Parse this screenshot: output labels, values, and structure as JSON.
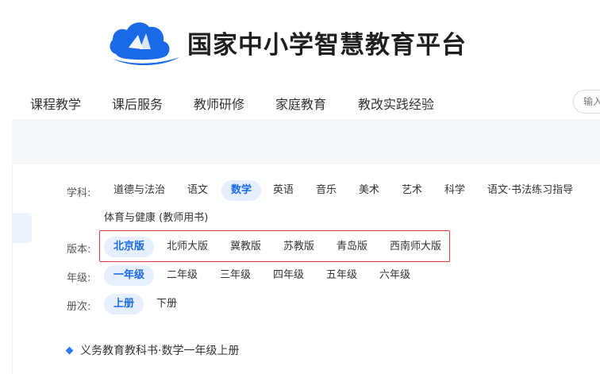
{
  "header": {
    "logo_text": "国家中小学智慧教育平台",
    "logo_icon": "cloud-book-icon",
    "brand_color": "#1a6ae8"
  },
  "nav": {
    "items": [
      "课程教学",
      "课后服务",
      "教师研修",
      "家庭教育",
      "教改实践经验"
    ],
    "search_placeholder": "输入"
  },
  "filters": {
    "subject": {
      "label": "学科:",
      "options": [
        "道德与法治",
        "语文",
        "数学",
        "英语",
        "音乐",
        "美术",
        "艺术",
        "科学",
        "语文·书法练习指导",
        "体育与健康 (教师用书)"
      ],
      "selected": "数学"
    },
    "edition": {
      "label": "版本:",
      "options": [
        "北京版",
        "北师大版",
        "冀教版",
        "苏教版",
        "青岛版",
        "西南师大版"
      ],
      "selected": "北京版",
      "highlight_color": "#e23b3b"
    },
    "grade": {
      "label": "年级:",
      "options": [
        "一年级",
        "二年级",
        "三年级",
        "四年级",
        "五年级",
        "六年级"
      ],
      "selected": "一年级"
    },
    "volume": {
      "label": "册次:",
      "options": [
        "上册",
        "下册"
      ],
      "selected": "上册"
    }
  },
  "book": {
    "title": "义务教育教科书·数学一年级上册"
  }
}
